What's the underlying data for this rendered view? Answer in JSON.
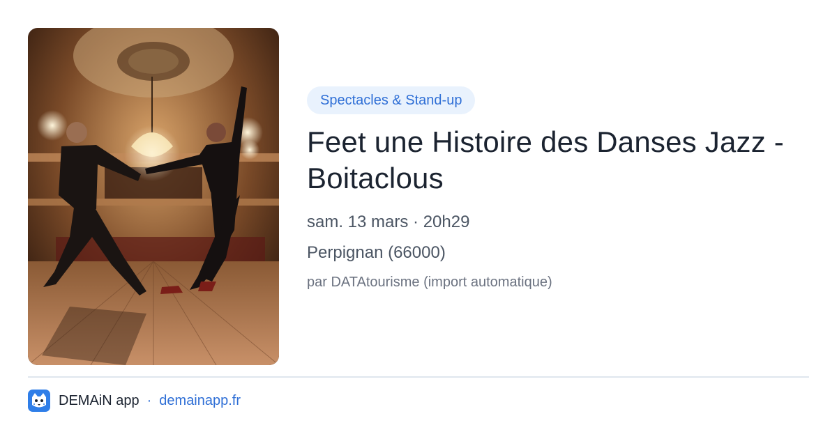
{
  "event": {
    "category": "Spectacles & Stand-up",
    "title": "Feet une Histoire des Danses Jazz - Boitaclous",
    "date_time": "sam. 13 mars · 20h29",
    "location": "Perpignan (66000)",
    "source": "par DATAtourisme (import automatique)"
  },
  "footer": {
    "app_name": "DEMAiN app",
    "separator": "·",
    "domain": "demainapp.fr"
  },
  "colors": {
    "accent": "#2f6fd6",
    "badge_background": "#e9f2fd",
    "title": "#1b2330",
    "meta": "#4b5563",
    "divider": "#dfe6ee"
  },
  "icons": {
    "app": "snow-leopard-app-icon"
  }
}
